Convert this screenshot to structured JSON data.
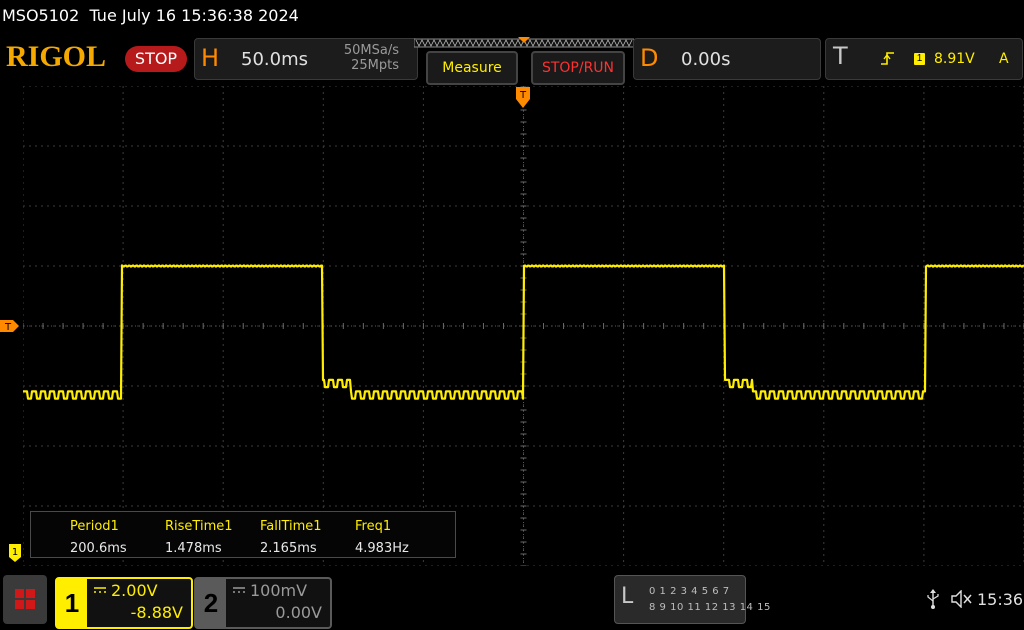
{
  "status": {
    "device": "MSO5102",
    "datetime": "Tue July 16 15:36:38 2024"
  },
  "brand": {
    "logo": "RIGOL",
    "run_state": "STOP"
  },
  "horizontal": {
    "letter": "H",
    "timebase": "50.0ms",
    "sample_rate": "50MSa/s",
    "memory_depth": "25Mpts"
  },
  "softkeys": {
    "measure": "Measure",
    "stop_run": "STOP/RUN"
  },
  "delay": {
    "letter": "D",
    "value": "0.00s"
  },
  "trigger": {
    "letter": "T",
    "source": "1",
    "level": "8.91V",
    "mode": "A",
    "edge": "rising-edge-icon"
  },
  "markers": {
    "trigger_level": "T",
    "ch1_ground": "1",
    "trigger_position": "T"
  },
  "measurements": [
    {
      "name": "Period1",
      "value": "200.6ms"
    },
    {
      "name": "RiseTime1",
      "value": "1.478ms"
    },
    {
      "name": "FallTime1",
      "value": "2.165ms"
    },
    {
      "name": "Freq1",
      "value": "4.983Hz"
    }
  ],
  "channels": {
    "ch1": {
      "number": "1",
      "scale": "2.00V",
      "offset": "-8.88V",
      "color": "#ffee00",
      "coupling_icon": "dc-coupling-icon"
    },
    "ch2": {
      "number": "2",
      "scale": "100mV",
      "offset": "0.00V",
      "color": "#9a9a9a",
      "coupling_icon": "dc-coupling-icon"
    }
  },
  "logic": {
    "letter": "L",
    "row1": "0 1 2 3  4 5 6 7",
    "row2": "8 9 10 11 12 13 14 15"
  },
  "system": {
    "clock": "15:36",
    "icons": [
      "usb-icon",
      "mute-icon"
    ]
  },
  "colors": {
    "trace": "#ffee00",
    "accent": "#ff8a00",
    "grid": "#3c3c3c",
    "stop": "#b71a1a"
  },
  "waveform": {
    "type": "square",
    "period_ms": 200.6,
    "timebase_ms_per_div": 50,
    "high_level_div": 1.0,
    "low_level_div": -1.15,
    "ripple_amplitude_div": 0.12
  }
}
